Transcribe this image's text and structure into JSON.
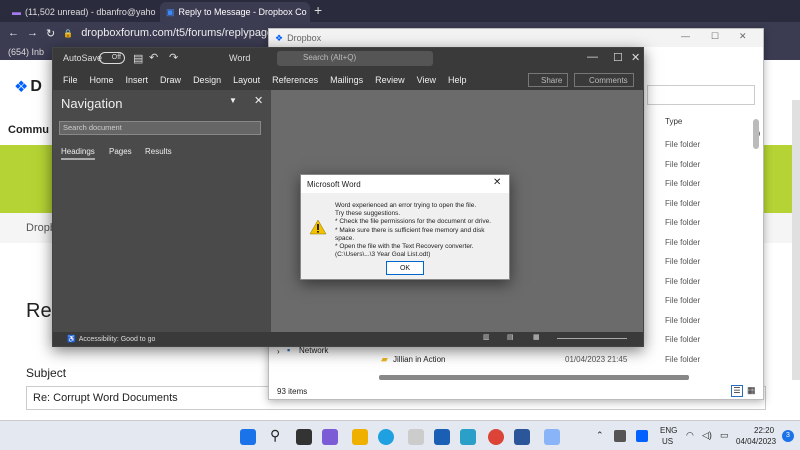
{
  "browser": {
    "tabs": [
      {
        "label": "(11,502 unread) - dbanfro@yaho",
        "active": false
      },
      {
        "label": "Reply to Message - Dropbox Co",
        "active": true
      }
    ],
    "new_tab": "+",
    "url": "dropboxforum.com/t5/forums/replypage/boa",
    "bookmark": "(654) Inb",
    "profile_initial": "D"
  },
  "dropbox_page": {
    "logo_text": "D",
    "community": "Commu",
    "breadcrumb": "Dropb",
    "heading": "Re",
    "subject_label": "Subject",
    "subject_value": "Re: Corrupt Word Documents"
  },
  "explorer": {
    "title": "Dropbox",
    "col_type": "Type",
    "rows": [
      "File folder",
      "File folder",
      "File folder",
      "File folder",
      "File folder",
      "File folder",
      "File folder",
      "File folder",
      "File folder",
      "File folder",
      "File folder",
      "File folder"
    ],
    "network": "Network",
    "last_item_name": "Jillian in Action",
    "last_item_date": "01/04/2023 21:45",
    "last_item_type": "File folder",
    "status": "93 items",
    "right_frag": "0"
  },
  "word": {
    "autosave": "AutoSave",
    "toggle": "Off",
    "app_name": "Word",
    "search_placeholder": "Search (Alt+Q)",
    "menu": [
      "File",
      "Home",
      "Insert",
      "Draw",
      "Design",
      "Layout",
      "References",
      "Mailings",
      "Review",
      "View",
      "Help"
    ],
    "share": "Share",
    "comments": "Comments",
    "nav_title": "Navigation",
    "nav_search": "Search document",
    "nav_tabs": [
      "Headings",
      "Pages",
      "Results"
    ],
    "status_accessibility": "Accessibility: Good to go"
  },
  "dialog": {
    "title": "Microsoft Word",
    "message_lines": [
      "Word experienced an error trying to open the file.",
      "Try these suggestions.",
      "* Check the file permissions for the document or drive.",
      "* Make sure there is sufficient free memory and disk space.",
      "* Open the file with the Text Recovery converter.",
      "(C:\\Users\\...\\3 Year Goal List.odt)"
    ],
    "ok": "OK"
  },
  "taskbar": {
    "lang": "ENG",
    "region": "US",
    "time": "22:20",
    "date": "04/04/2023",
    "notif": "3"
  }
}
